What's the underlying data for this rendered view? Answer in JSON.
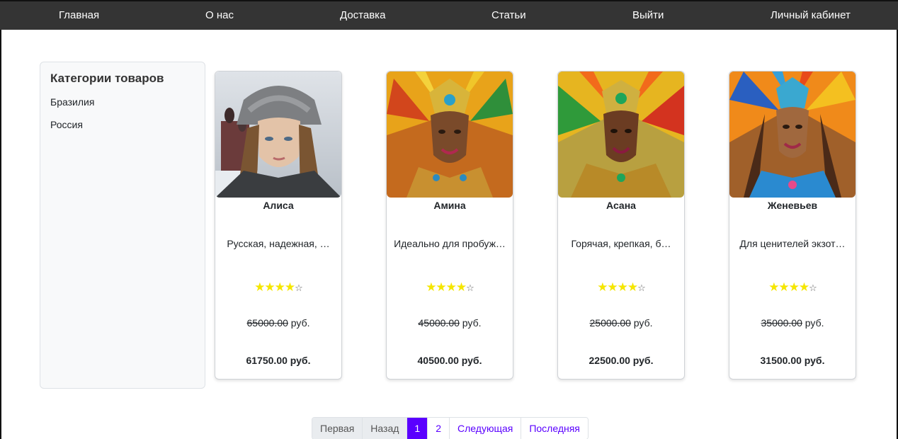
{
  "nav": {
    "home": "Главная",
    "about": "О нас",
    "delivery": "Доставка",
    "articles": "Статьи",
    "logout": "Выйти",
    "account": "Личный кабинет"
  },
  "sidebar": {
    "title": "Категории товаров",
    "categories": [
      "Бразилия",
      "Россия"
    ]
  },
  "products": [
    {
      "name": "Алиса",
      "desc": "Русская, надежная, …",
      "rating": 4,
      "rating_max": 5,
      "old_price": "65000.00",
      "new_price": "61750.00 руб.",
      "image_icon": "product-photo"
    },
    {
      "name": "Амина",
      "desc": "Идеально для пробуж…",
      "rating": 4,
      "rating_max": 5,
      "old_price": "45000.00",
      "new_price": "40500.00 руб.",
      "image_icon": "product-photo"
    },
    {
      "name": "Асана",
      "desc": "Горячая, крепкая, б…",
      "rating": 4,
      "rating_max": 5,
      "old_price": "25000.00",
      "new_price": "22500.00 руб.",
      "image_icon": "product-photo"
    },
    {
      "name": "Женевьев",
      "desc": "Для ценителей экзот…",
      "rating": 4,
      "rating_max": 5,
      "old_price": "35000.00",
      "new_price": "31500.00 руб.",
      "image_icon": "product-photo"
    }
  ],
  "currency": "руб.",
  "pagination": {
    "first": "Первая",
    "prev": "Назад",
    "page1": "1",
    "page2": "2",
    "next": "Следующая",
    "last": "Последняя"
  },
  "colors": {
    "nav_bg": "#343434",
    "accent": "#5a00ff",
    "star": "#f5e600"
  }
}
